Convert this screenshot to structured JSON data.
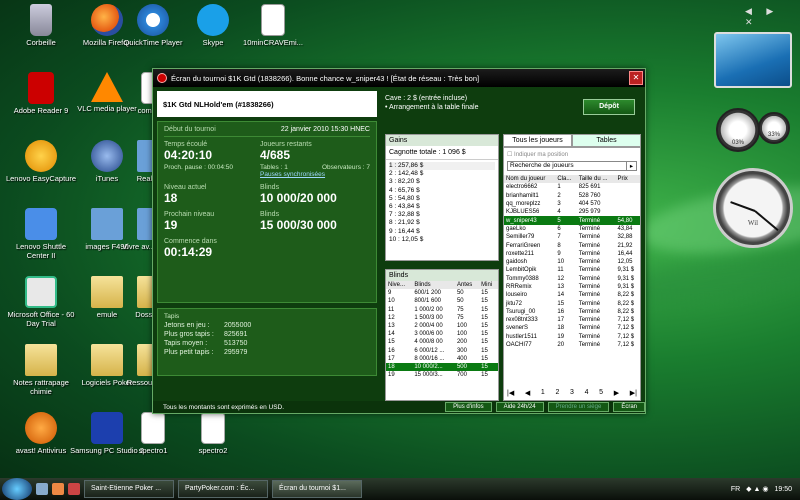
{
  "desktop": {
    "icons": [
      {
        "label": "Corbeille",
        "type": "bin"
      },
      {
        "label": "Mozilla Firefox",
        "type": "firefox"
      },
      {
        "label": "QuickTime Player",
        "type": "qt"
      },
      {
        "label": "Skype",
        "type": "skype"
      },
      {
        "label": "10minCRAVEmi...",
        "type": "mp3"
      },
      {
        "label": "Adobe Reader 9",
        "type": "adobe"
      },
      {
        "label": "VLC media player",
        "type": "vlc"
      },
      {
        "label": "comma...",
        "type": "doc"
      },
      {
        "label": "Lenovo EasyCapture",
        "type": "lenovo"
      },
      {
        "label": "iTunes",
        "type": "itunes"
      },
      {
        "label": "RealPla...",
        "type": "img"
      },
      {
        "label": "Lenovo Shuttle Center II",
        "type": "shuttle"
      },
      {
        "label": "images F490",
        "type": "img"
      },
      {
        "label": "Vivre av... jambe...",
        "type": "img"
      },
      {
        "label": "Microsoft Office - 60 Day Trial",
        "type": "office"
      },
      {
        "label": "emule",
        "type": "folder"
      },
      {
        "label": "Dossiers...",
        "type": "folder"
      },
      {
        "label": "Notes rattrapage chimie",
        "type": "folder"
      },
      {
        "label": "Logiciels Poker",
        "type": "folder"
      },
      {
        "label": "Ressou... pou...",
        "type": "folder"
      },
      {
        "label": "avast! Antivirus",
        "type": "avast"
      },
      {
        "label": "Samsung PC Studio 3",
        "type": "samsung"
      },
      {
        "label": "spectro1",
        "type": "doc"
      },
      {
        "label": "spectro2",
        "type": "doc"
      }
    ],
    "clock_brand": "Wil",
    "cpu_pct": "03%",
    "mem_pct": "33%"
  },
  "window": {
    "title": "Écran du tournoi $1K Gtd (1838266). Bonne chance w_sniper43 !    [État de réseau : Très bon]",
    "tournament_name": "$1K Gtd NLHold'em (#1838266)",
    "start_label": "Début du tournoi",
    "start_value": "22 janvier 2010  15:30 HNEC",
    "elapsed_label": "Temps écoulé",
    "elapsed_value": "04:20:10",
    "players_left_label": "Joueurs restants",
    "players_left_value": "4/685",
    "next_pause_label": "Proch. pause : 00:04:50",
    "tables_label": "Tables : 1",
    "observers_label": "Observateurs : 7",
    "sync_pauses": "Pauses synchronisées",
    "level_label": "Niveau actuel",
    "level_value": "18",
    "blinds_label": "Blinds",
    "blinds_value": "10 000/20 000",
    "next_level_label": "Prochain niveau",
    "next_level_value": "19",
    "next_blinds_label": "Blinds",
    "next_blinds_value": "15 000/30 000",
    "starts_in_label": "Commence dans",
    "starts_in_value": "00:14:29",
    "stacks_title": "Tapis",
    "stacks": [
      {
        "label": "Jetons en jeu :",
        "value": "2055000"
      },
      {
        "label": "Plus gros tapis :",
        "value": "825691"
      },
      {
        "label": "Tapis moyen :",
        "value": "513750"
      },
      {
        "label": "Plus petit tapis :",
        "value": "295979"
      }
    ],
    "cave_line1": "Cave : 2 $ (entrée incluse)",
    "cave_line2": "• Arrangement à la table finale",
    "depot": "Dépôt",
    "gains_title": "Gains",
    "cagnotte": "Cagnotte totale : 1 096 $",
    "gains": [
      "1 : 257,86 $",
      "2 : 142,48 $",
      "3 : 82,20 $",
      "4 : 65,76 $",
      "5 : 54,80 $",
      "6 : 43,84 $",
      "7 : 32,88 $",
      "8 : 21,92 $",
      "9 : 16,44 $",
      "10 : 12,05 $"
    ],
    "blinds_title": "Blinds",
    "blinds_headers": [
      "Nive...",
      "Blinds",
      "Antes",
      "Mini"
    ],
    "blinds_rows": [
      [
        "9",
        "600/1 200",
        "50",
        "15"
      ],
      [
        "10",
        "800/1 600",
        "50",
        "15"
      ],
      [
        "11",
        "1 000/2 00",
        "75",
        "15"
      ],
      [
        "12",
        "1 500/3 00",
        "75",
        "15"
      ],
      [
        "13",
        "2 000/4 00",
        "100",
        "15"
      ],
      [
        "14",
        "3 000/6 00",
        "100",
        "15"
      ],
      [
        "15",
        "4 000/8 00",
        "200",
        "15"
      ],
      [
        "16",
        "6 000/12 ...",
        "300",
        "15"
      ],
      [
        "17",
        "8 000/16 ...",
        "400",
        "15"
      ],
      [
        "18",
        "10 000/2...",
        "500",
        "15"
      ],
      [
        "19",
        "15 000/3...",
        "700",
        "15"
      ]
    ],
    "selected_blind_level": "18",
    "tab_all": "Tous les joueurs",
    "tab_tables": "Tables",
    "show_position": "Indiquer ma position",
    "search_placeholder": "Recherche de joueurs",
    "player_headers": [
      "Nom du joueur",
      "Cla...",
      "Taille du ...",
      "Prix"
    ],
    "players": [
      [
        "electro6662",
        "1",
        "825 691",
        ""
      ],
      [
        "brianhamilt1",
        "2",
        "528 760",
        ""
      ],
      [
        "qq_moreplzz",
        "3",
        "404 570",
        ""
      ],
      [
        "KJBLUES56",
        "4",
        "295 979",
        ""
      ],
      [
        "w_sniper43",
        "5",
        "Terminé",
        "54,80"
      ],
      [
        "gaeLko",
        "6",
        "Terminé",
        "43,84"
      ],
      [
        "Semiller79",
        "7",
        "Terminé",
        "32,88"
      ],
      [
        "FerrariGreen",
        "8",
        "Terminé",
        "21,92"
      ],
      [
        "roxette211",
        "9",
        "Terminé",
        "16,44"
      ],
      [
        "gaidosh",
        "10",
        "Terminé",
        "12,05"
      ],
      [
        "LembitOpik",
        "11",
        "Terminé",
        "9,31 $"
      ],
      [
        "Tommy0388",
        "12",
        "Terminé",
        "9,31 $"
      ],
      [
        "RRRemix",
        "13",
        "Terminé",
        "9,31 $"
      ],
      [
        "louseiro",
        "14",
        "Terminé",
        "8,22 $"
      ],
      [
        "jktu72",
        "15",
        "Terminé",
        "8,22 $"
      ],
      [
        "Tsurugi_00",
        "16",
        "Terminé",
        "8,22 $"
      ],
      [
        "rex08tnt333",
        "17",
        "Terminé",
        "7,12 $"
      ],
      [
        "svenerS",
        "18",
        "Terminé",
        "7,12 $"
      ],
      [
        "hustler1511",
        "19",
        "Terminé",
        "7,12 $"
      ],
      [
        "OACHI77",
        "20",
        "Terminé",
        "7,12 $"
      ]
    ],
    "pages": [
      "1",
      "2",
      "3",
      "4",
      "5"
    ],
    "footer_note": "Tous les montants sont exprimés en USD.",
    "btn_more": "Plus d'infos",
    "btn_help": "Aide 24h/24",
    "btn_seat": "Prendre un siège",
    "btn_screen": "Écran"
  },
  "taskbar": {
    "tasks": [
      "Saint-Etienne Poker ...",
      "PartyPoker.com : Éc...",
      "Écran du tournoi $1..."
    ],
    "lang": "FR",
    "time": "19:50"
  }
}
